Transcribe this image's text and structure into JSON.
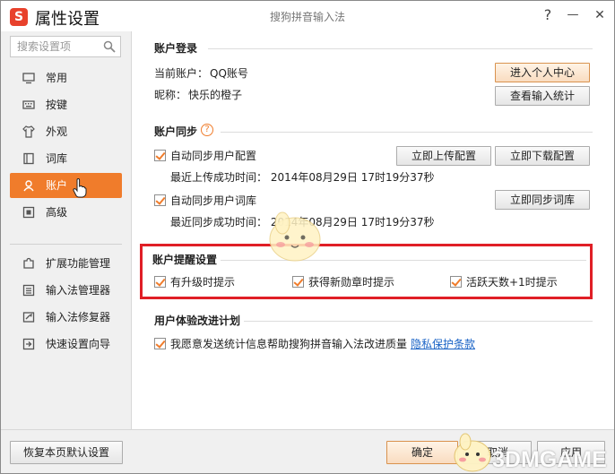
{
  "window": {
    "title": "属性设置",
    "center_title": "搜狗拼音输入法",
    "help_label": "?",
    "minimize_label": "—",
    "close_label": "✕",
    "logo_letter": "S"
  },
  "sidebar": {
    "search_placeholder": "搜索设置项",
    "items": [
      {
        "label": "常用",
        "icon": "monitor-icon"
      },
      {
        "label": "按键",
        "icon": "keyboard-icon"
      },
      {
        "label": "外观",
        "icon": "shirt-icon"
      },
      {
        "label": "词库",
        "icon": "book-icon"
      },
      {
        "label": "账户",
        "icon": "user-icon",
        "active": true
      },
      {
        "label": "高级",
        "icon": "advanced-icon"
      }
    ],
    "tools": [
      {
        "label": "扩展功能管理",
        "icon": "puzzle-icon"
      },
      {
        "label": "输入法管理器",
        "icon": "list-icon"
      },
      {
        "label": "输入法修复器",
        "icon": "wrench-icon"
      },
      {
        "label": "快速设置向导",
        "icon": "wizard-icon"
      }
    ]
  },
  "account_login": {
    "title": "账户登录",
    "current_label": "当前账户：",
    "current_value": "QQ账号",
    "nickname_label": "昵称：",
    "nickname_value": "快乐的橙子",
    "btn_personal_center": "进入个人中心",
    "btn_view_stats": "查看输入统计"
  },
  "account_sync": {
    "title": "账户同步",
    "help_label": "?",
    "auto_sync_config": "自动同步用户配置",
    "last_upload": "最近上传成功时间：  2014年08月29日  17时19分37秒",
    "btn_upload_config": "立即上传配置",
    "btn_download_config": "立即下载配置",
    "auto_sync_dict": "自动同步用户词库",
    "last_sync": "最近同步成功时间：  2014年08月29日  17时19分37秒",
    "btn_sync_dict": "立即同步词库"
  },
  "reminders": {
    "title": "账户提醒设置",
    "opt_upgrade": "有升级时提示",
    "opt_medal": "获得新勋章时提示",
    "opt_active_days": "活跃天数+1时提示"
  },
  "ux_plan": {
    "title": "用户体验改进计划",
    "agree_text": "我愿意发送统计信息帮助搜狗拼音输入法改进质量",
    "privacy_link": "隐私保护条款"
  },
  "footer": {
    "restore_defaults": "恢复本页默认设置",
    "ok": "确定",
    "cancel": "取消",
    "apply": "应用"
  },
  "watermark": "3DMGAME",
  "colors": {
    "accent": "#f07c2b",
    "highlight_box": "#e01f26",
    "link": "#1a63c6"
  }
}
